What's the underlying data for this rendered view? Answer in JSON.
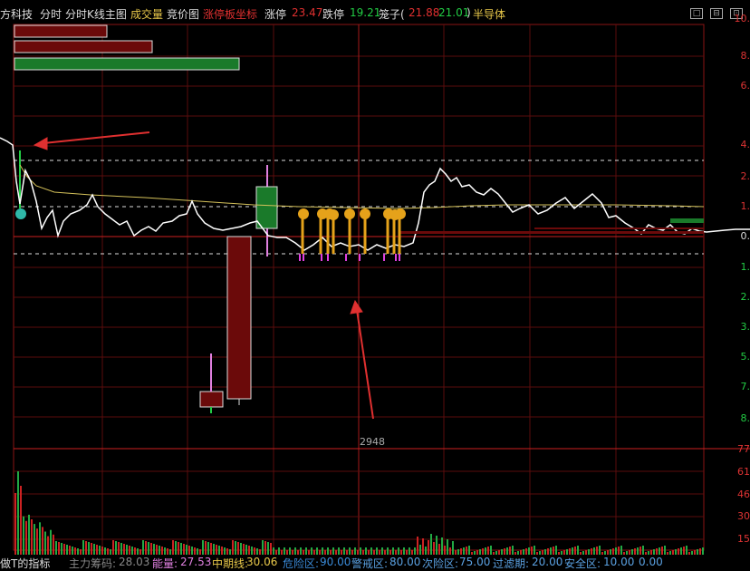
{
  "header": {
    "stock_name": "方科技",
    "tab_fenshi": "分时",
    "tab_kline": "分时K线主图",
    "menu_volume": "成交量",
    "menu_auction": "竞价图",
    "menu_limitboard": "涨停板坐标",
    "limit_up_label": "涨停",
    "limit_up_value": "23.47",
    "limit_down_label": "跌停",
    "limit_down_value": "19.21",
    "cage_label": "笼子(",
    "cage_high": "21.88",
    "cage_low": "21.01",
    "cage_close": ")",
    "sector": "半导体",
    "window_buttons": [
      "□",
      "⊟",
      "⊡"
    ]
  },
  "chart": {
    "volume_marker": "2948",
    "right_axis_labels": [
      "10.",
      "8.",
      "6.",
      "4.",
      "2.",
      "1.",
      "0.",
      "1.",
      "2.",
      "3.",
      "5.",
      "7.",
      "8."
    ],
    "volume_axis_labels": [
      "77",
      "61",
      "46",
      "30",
      "15"
    ],
    "colors": {
      "up": "#cc2222",
      "down": "#22aa44",
      "price_line": "#ffffff",
      "avg_line": "#d4c15a",
      "grid": "#7a1010",
      "dark_red_fill": "#6b0a0a",
      "green_fill": "#1a7a2a",
      "signal_icon": "#e5a21a",
      "pink_tick": "#e040e0",
      "arrow": "#e03030"
    }
  },
  "footer": {
    "indicator_name": "做T的指标",
    "items": [
      {
        "label": "主力筹码:",
        "value": "28.03"
      },
      {
        "label": "能量:",
        "value": "27.53"
      },
      {
        "label": "中期线:",
        "value": "30.06"
      },
      {
        "label": "危险区:",
        "value": "90.00"
      },
      {
        "label": "警戒区:",
        "value": "80.00"
      },
      {
        "label": "次险区:",
        "value": "75.00"
      },
      {
        "label": "过滤期:",
        "value": "20.00"
      },
      {
        "label": "安全区:",
        "value": "10.00"
      },
      {
        "label": "",
        "value": "0.00"
      }
    ]
  }
}
